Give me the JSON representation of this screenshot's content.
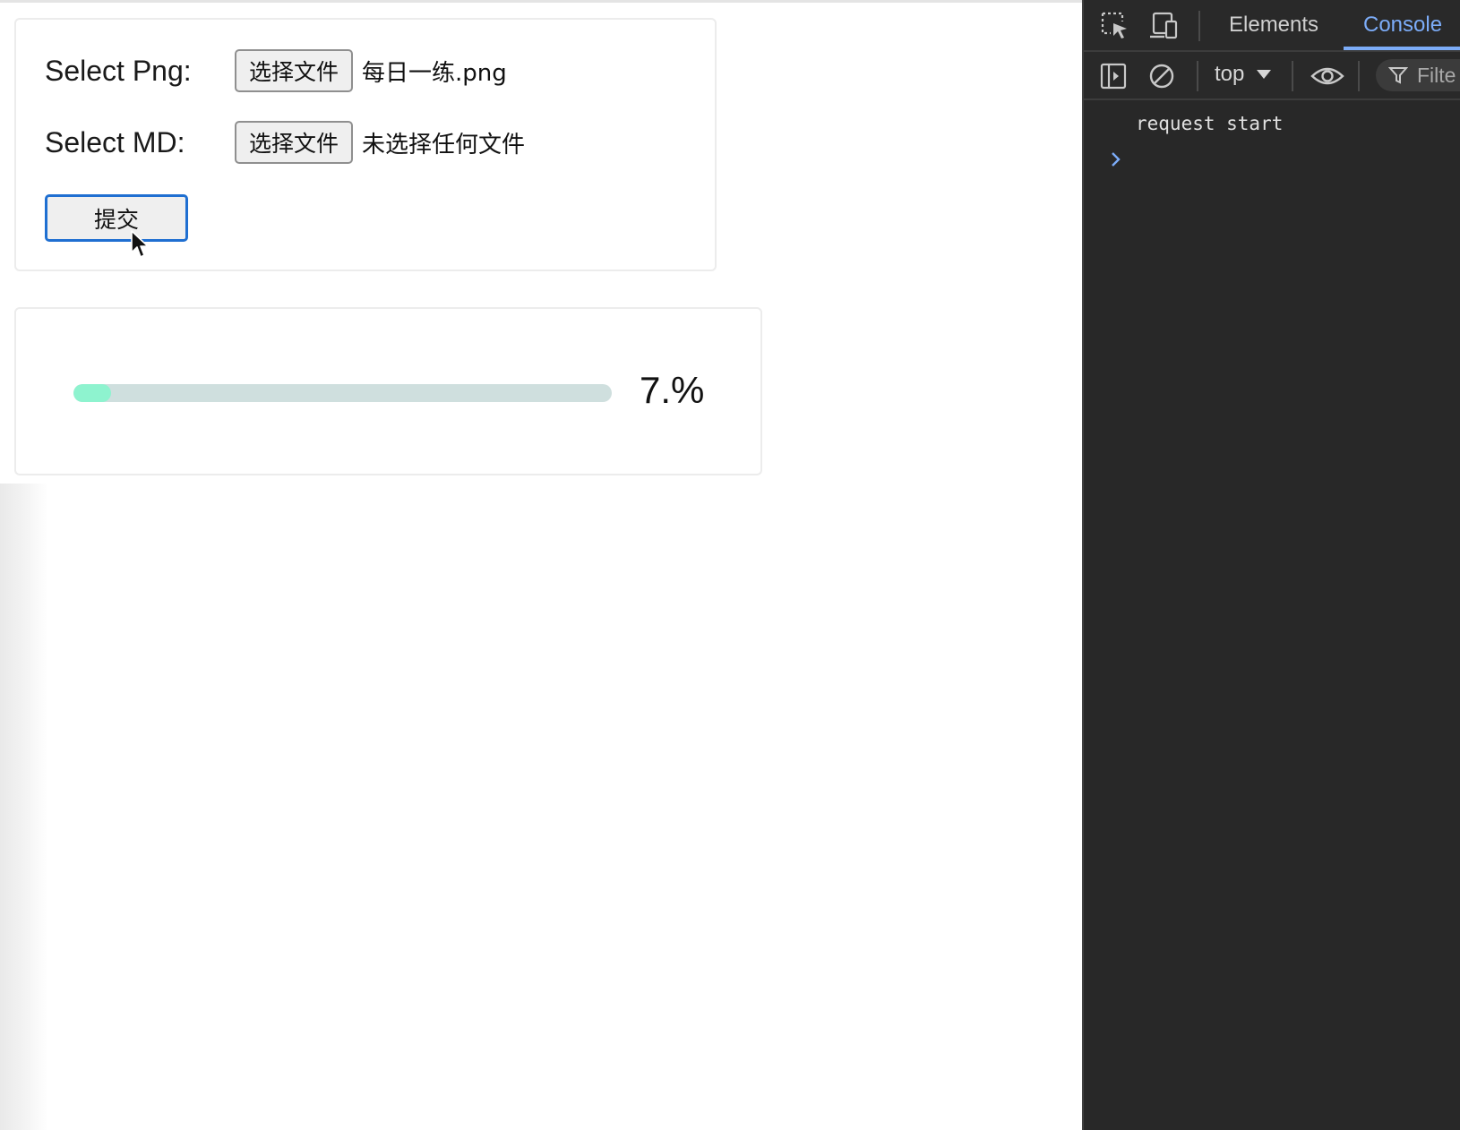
{
  "form": {
    "png_label": "Select Png:",
    "png_button": "选择文件",
    "png_file": "每日一练.png",
    "md_label": "Select MD:",
    "md_button": "选择文件",
    "md_file": "未选择任何文件",
    "submit": "提交"
  },
  "progress": {
    "value": 0.07,
    "text": "7.%",
    "fill_color": "#8ef3cf",
    "track_color": "#cfdfde"
  },
  "devtools": {
    "tabs": {
      "elements": "Elements",
      "console": "Console"
    },
    "context": "top",
    "filter": "Filte",
    "log": "request start",
    "accent": "#7cacf8"
  }
}
